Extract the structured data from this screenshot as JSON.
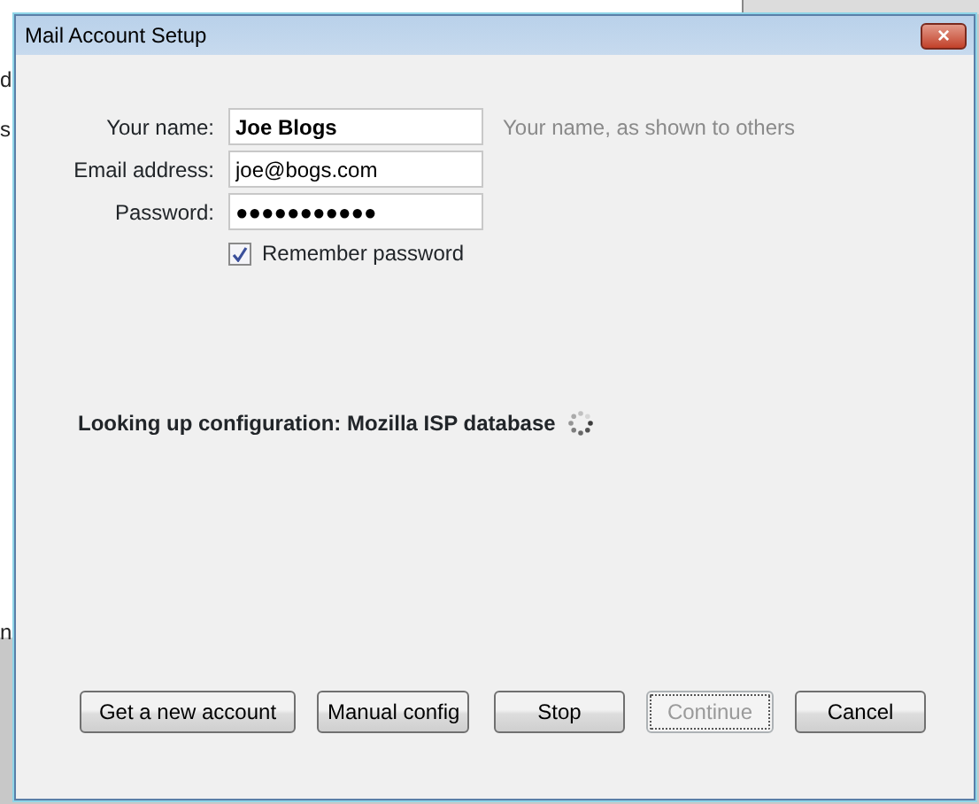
{
  "background_window": {
    "fragments": [
      "d",
      "s",
      "n"
    ]
  },
  "window": {
    "title": "Mail Account Setup",
    "close_label": "×"
  },
  "fields": [
    {
      "label": "Your name:",
      "value": "Joe Blogs",
      "hint": "Your name, as shown to others",
      "bold": true
    },
    {
      "label": "Email address:",
      "value": "joe@bogs.com"
    },
    {
      "label": "Password:",
      "value": "●●●●●●●●●●●"
    }
  ],
  "remember_password": {
    "label": "Remember password",
    "checked": true
  },
  "status": {
    "text": "Looking up configuration: Mozilla ISP database",
    "busy": true
  },
  "buttons": [
    {
      "label": "Get a new account",
      "disabled": false,
      "focused": false
    },
    {
      "label": "Manual config",
      "disabled": false,
      "focused": false
    },
    {
      "label": "Stop",
      "disabled": false,
      "focused": false
    },
    {
      "label": "Continue",
      "disabled": true,
      "focused": true
    },
    {
      "label": "Cancel",
      "disabled": false,
      "focused": false
    }
  ]
}
